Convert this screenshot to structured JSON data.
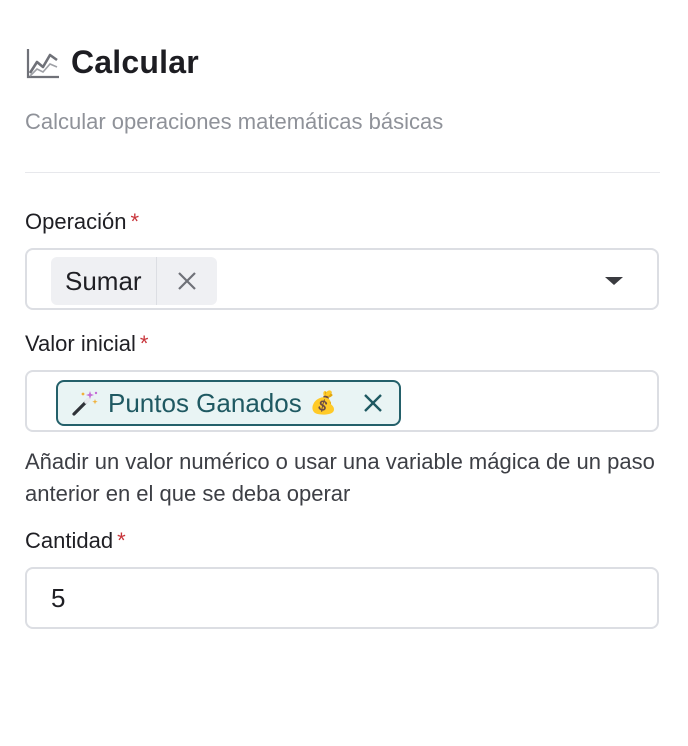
{
  "header": {
    "title": "Calcular",
    "subtitle": "Calcular operaciones matemáticas básicas",
    "icon": "chart-line-icon"
  },
  "operation": {
    "label": "Operación",
    "required_mark": "*",
    "selected": "Sumar"
  },
  "initial_value": {
    "label": "Valor inicial",
    "required_mark": "*",
    "variable": "Puntos Ganados",
    "variable_emoji": "💰",
    "help": "Añadir un valor numérico o usar una variable mágica de un paso anterior en el que se deba operar"
  },
  "quantity": {
    "label": "Cantidad",
    "required_mark": "*",
    "value": "5"
  },
  "colors": {
    "required": "#c8343a",
    "magic_chip_border": "#24606a",
    "magic_chip_text": "#1f5962",
    "subtitle": "#8f9299"
  }
}
